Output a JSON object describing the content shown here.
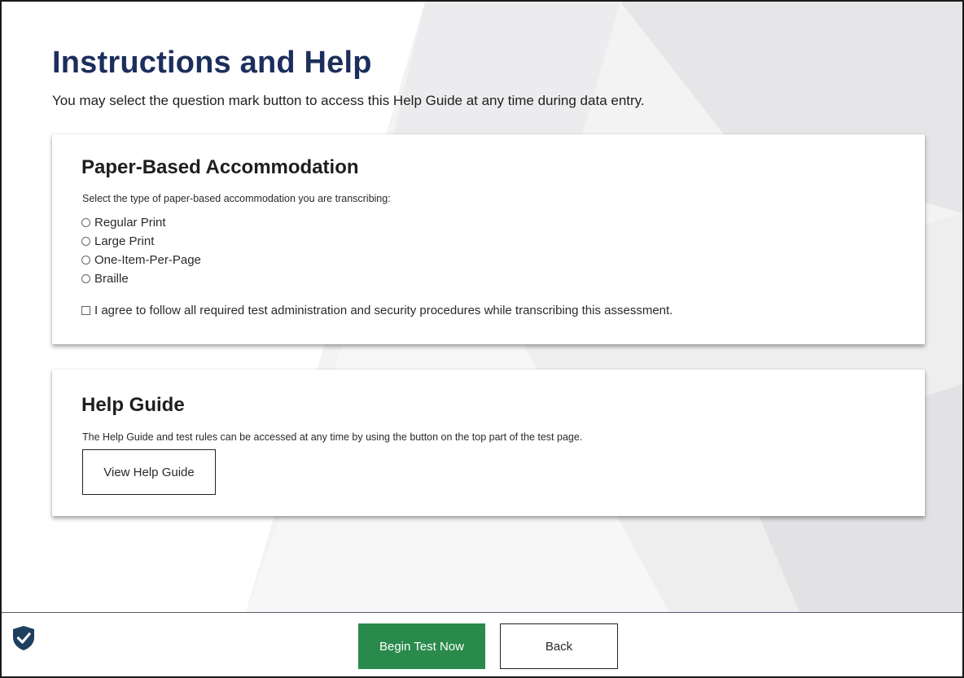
{
  "page": {
    "title": "Instructions and Help",
    "subtitle": "You may select the question mark button to access this Help Guide at any time during data entry."
  },
  "accommodation": {
    "title": "Paper-Based Accommodation",
    "instruction": "Select the type of paper-based accommodation you are transcribing:",
    "options": [
      {
        "label": "Regular Print",
        "selected": false
      },
      {
        "label": "Large Print",
        "selected": false
      },
      {
        "label": "One-Item-Per-Page",
        "selected": false
      },
      {
        "label": "Braille",
        "selected": false
      }
    ],
    "agreement": {
      "label": "I agree to follow all required test administration and security procedures while transcribing this assessment.",
      "checked": false
    }
  },
  "help_guide": {
    "title": "Help Guide",
    "text": "The Help Guide and test rules can be accessed at any time by using the button on the top part of the test page.",
    "button_label": "View Help Guide"
  },
  "footer": {
    "icon": "shield-check-icon",
    "begin_label": "Begin Test Now",
    "back_label": "Back"
  },
  "colors": {
    "title": "#1c2e5c",
    "begin_button": "#2a8a4c",
    "shield": "#1f3f5f"
  }
}
